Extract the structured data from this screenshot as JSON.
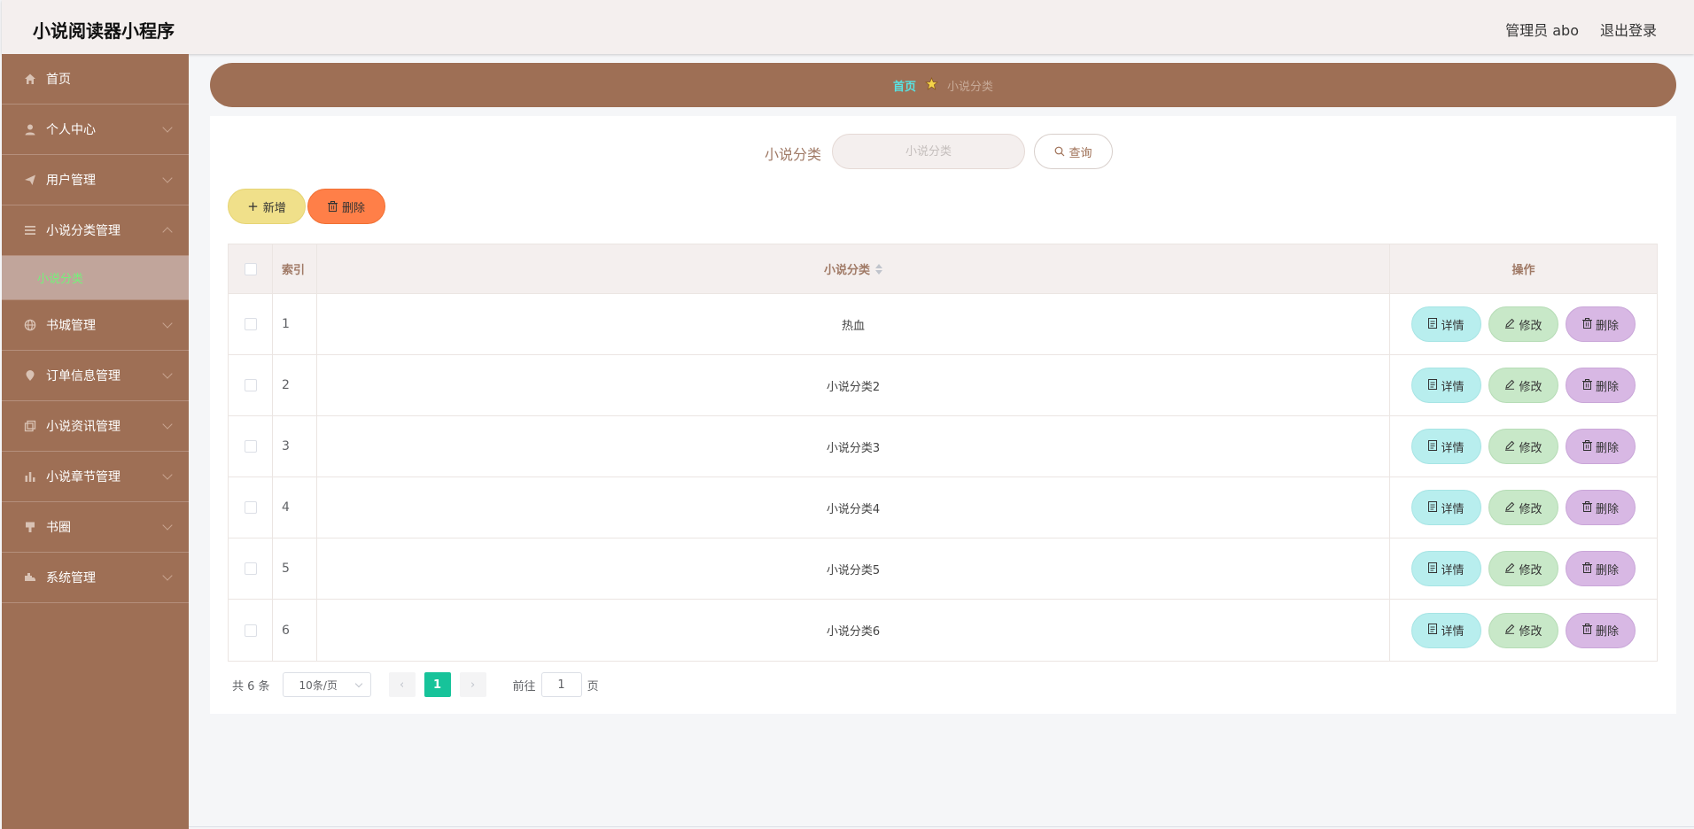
{
  "header": {
    "app_title": "小说阅读器小程序",
    "admin_label": "管理员 abo",
    "logout_label": "退出登录"
  },
  "sidebar": {
    "items": [
      {
        "label": "首页",
        "icon": "home-icon",
        "has_chevron": false
      },
      {
        "label": "个人中心",
        "icon": "user-icon",
        "has_chevron": true
      },
      {
        "label": "用户管理",
        "icon": "send-icon",
        "has_chevron": true
      },
      {
        "label": "小说分类管理",
        "icon": "menu-icon",
        "has_chevron": true,
        "expanded": true
      },
      {
        "label": "书城管理",
        "icon": "globe-icon",
        "has_chevron": true
      },
      {
        "label": "订单信息管理",
        "icon": "location-icon",
        "has_chevron": true
      },
      {
        "label": "小说资讯管理",
        "icon": "copy-icon",
        "has_chevron": true
      },
      {
        "label": "小说章节管理",
        "icon": "chart-icon",
        "has_chevron": true
      },
      {
        "label": "书圈",
        "icon": "brush-icon",
        "has_chevron": true
      },
      {
        "label": "系统管理",
        "icon": "truck-icon",
        "has_chevron": true
      }
    ],
    "submenu_active": "小说分类"
  },
  "breadcrumb": {
    "home": "首页",
    "current": "小说分类"
  },
  "search": {
    "label": "小说分类",
    "placeholder": "小说分类",
    "query_label": "查询"
  },
  "actions": {
    "add_label": "新增",
    "delete_label": "删除"
  },
  "table": {
    "columns": {
      "index": "索引",
      "name": "小说分类",
      "ops": "操作"
    },
    "rows": [
      {
        "index": "1",
        "name": "热血"
      },
      {
        "index": "2",
        "name": "小说分类2"
      },
      {
        "index": "3",
        "name": "小说分类3"
      },
      {
        "index": "4",
        "name": "小说分类4"
      },
      {
        "index": "5",
        "name": "小说分类5"
      },
      {
        "index": "6",
        "name": "小说分类6"
      }
    ],
    "row_actions": {
      "detail": "详情",
      "edit": "修改",
      "delete": "删除"
    }
  },
  "pagination": {
    "total": "共 6 条",
    "page_size": "10条/页",
    "current_page": "1",
    "goto_prefix": "前往",
    "goto_value": "1",
    "goto_suffix": "页"
  },
  "colors": {
    "sidebar_bg": "#9e6f55",
    "header_bg": "#f4efee",
    "active_submenu_text": "#74f27a",
    "breadcrumb_home": "#58e3e3",
    "pager_active": "#17c39a",
    "add_button": "#f0e08a",
    "delete_button": "#ff7f48"
  }
}
